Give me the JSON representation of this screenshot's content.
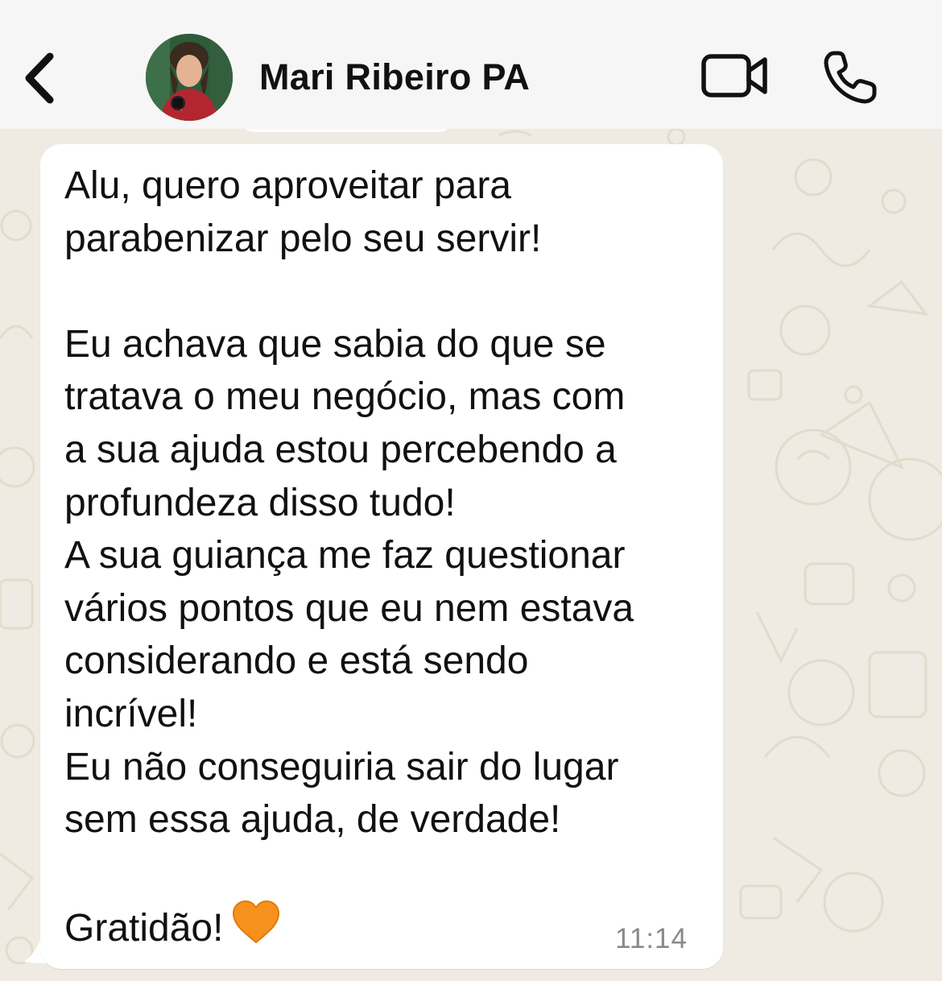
{
  "header": {
    "contact_name": "Mari Ribeiro PA",
    "back_icon": "chevron-left-icon",
    "video_icon": "video-camera-icon",
    "call_icon": "phone-icon"
  },
  "message": {
    "lines": [
      "Alu, quero aproveitar para",
      "parabenizar pelo seu servir!",
      "",
      "Eu achava que sabia do que se",
      "tratava o meu negócio, mas com",
      "a sua ajuda estou percebendo a",
      "profundeza disso tudo!",
      "A sua guiança me faz questionar",
      "vários pontos que eu nem estava",
      "considerando e está sendo",
      "incrível!",
      "Eu não conseguiria sair do lugar",
      "sem essa ajuda, de verdade!",
      ""
    ],
    "last_line": "Gratidão!",
    "emoji_icon": "orange-heart-icon",
    "time": "11:14"
  },
  "colors": {
    "chat_background": "#efeae2",
    "bubble": "#ffffff",
    "header": "#f6f6f6",
    "heart": "#f7911e",
    "timestamp": "#8a8a8a"
  }
}
